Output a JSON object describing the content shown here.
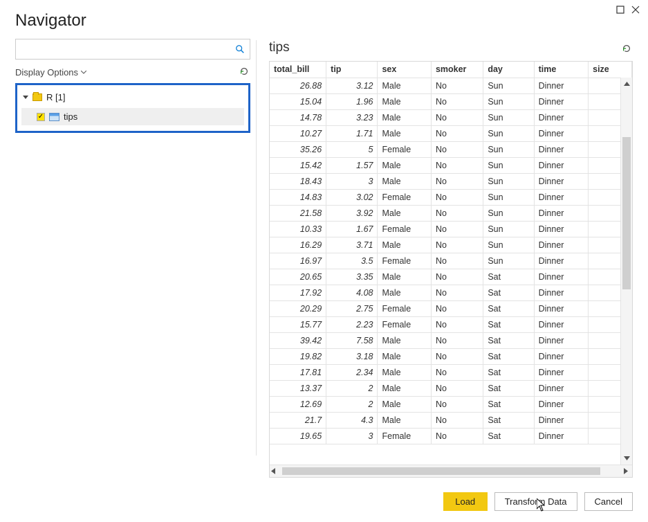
{
  "window": {
    "title": "Navigator"
  },
  "left": {
    "search_placeholder": "",
    "display_options_label": "Display Options",
    "tree": {
      "root_label": "R [1]",
      "child_label": "tips",
      "child_checked": true
    }
  },
  "preview": {
    "title": "tips",
    "columns": [
      "total_bill",
      "tip",
      "sex",
      "smoker",
      "day",
      "time",
      "size"
    ],
    "rows": [
      {
        "total_bill": "26.88",
        "tip": "3.12",
        "sex": "Male",
        "smoker": "No",
        "day": "Sun",
        "time": "Dinner",
        "size": ""
      },
      {
        "total_bill": "15.04",
        "tip": "1.96",
        "sex": "Male",
        "smoker": "No",
        "day": "Sun",
        "time": "Dinner",
        "size": ""
      },
      {
        "total_bill": "14.78",
        "tip": "3.23",
        "sex": "Male",
        "smoker": "No",
        "day": "Sun",
        "time": "Dinner",
        "size": ""
      },
      {
        "total_bill": "10.27",
        "tip": "1.71",
        "sex": "Male",
        "smoker": "No",
        "day": "Sun",
        "time": "Dinner",
        "size": ""
      },
      {
        "total_bill": "35.26",
        "tip": "5",
        "sex": "Female",
        "smoker": "No",
        "day": "Sun",
        "time": "Dinner",
        "size": ""
      },
      {
        "total_bill": "15.42",
        "tip": "1.57",
        "sex": "Male",
        "smoker": "No",
        "day": "Sun",
        "time": "Dinner",
        "size": ""
      },
      {
        "total_bill": "18.43",
        "tip": "3",
        "sex": "Male",
        "smoker": "No",
        "day": "Sun",
        "time": "Dinner",
        "size": ""
      },
      {
        "total_bill": "14.83",
        "tip": "3.02",
        "sex": "Female",
        "smoker": "No",
        "day": "Sun",
        "time": "Dinner",
        "size": ""
      },
      {
        "total_bill": "21.58",
        "tip": "3.92",
        "sex": "Male",
        "smoker": "No",
        "day": "Sun",
        "time": "Dinner",
        "size": ""
      },
      {
        "total_bill": "10.33",
        "tip": "1.67",
        "sex": "Female",
        "smoker": "No",
        "day": "Sun",
        "time": "Dinner",
        "size": ""
      },
      {
        "total_bill": "16.29",
        "tip": "3.71",
        "sex": "Male",
        "smoker": "No",
        "day": "Sun",
        "time": "Dinner",
        "size": ""
      },
      {
        "total_bill": "16.97",
        "tip": "3.5",
        "sex": "Female",
        "smoker": "No",
        "day": "Sun",
        "time": "Dinner",
        "size": ""
      },
      {
        "total_bill": "20.65",
        "tip": "3.35",
        "sex": "Male",
        "smoker": "No",
        "day": "Sat",
        "time": "Dinner",
        "size": ""
      },
      {
        "total_bill": "17.92",
        "tip": "4.08",
        "sex": "Male",
        "smoker": "No",
        "day": "Sat",
        "time": "Dinner",
        "size": ""
      },
      {
        "total_bill": "20.29",
        "tip": "2.75",
        "sex": "Female",
        "smoker": "No",
        "day": "Sat",
        "time": "Dinner",
        "size": ""
      },
      {
        "total_bill": "15.77",
        "tip": "2.23",
        "sex": "Female",
        "smoker": "No",
        "day": "Sat",
        "time": "Dinner",
        "size": ""
      },
      {
        "total_bill": "39.42",
        "tip": "7.58",
        "sex": "Male",
        "smoker": "No",
        "day": "Sat",
        "time": "Dinner",
        "size": ""
      },
      {
        "total_bill": "19.82",
        "tip": "3.18",
        "sex": "Male",
        "smoker": "No",
        "day": "Sat",
        "time": "Dinner",
        "size": ""
      },
      {
        "total_bill": "17.81",
        "tip": "2.34",
        "sex": "Male",
        "smoker": "No",
        "day": "Sat",
        "time": "Dinner",
        "size": ""
      },
      {
        "total_bill": "13.37",
        "tip": "2",
        "sex": "Male",
        "smoker": "No",
        "day": "Sat",
        "time": "Dinner",
        "size": ""
      },
      {
        "total_bill": "12.69",
        "tip": "2",
        "sex": "Male",
        "smoker": "No",
        "day": "Sat",
        "time": "Dinner",
        "size": ""
      },
      {
        "total_bill": "21.7",
        "tip": "4.3",
        "sex": "Male",
        "smoker": "No",
        "day": "Sat",
        "time": "Dinner",
        "size": ""
      },
      {
        "total_bill": "19.65",
        "tip": "3",
        "sex": "Female",
        "smoker": "No",
        "day": "Sat",
        "time": "Dinner",
        "size": ""
      }
    ]
  },
  "footer": {
    "load_label": "Load",
    "transform_label": "Transform Data",
    "cancel_label": "Cancel"
  }
}
